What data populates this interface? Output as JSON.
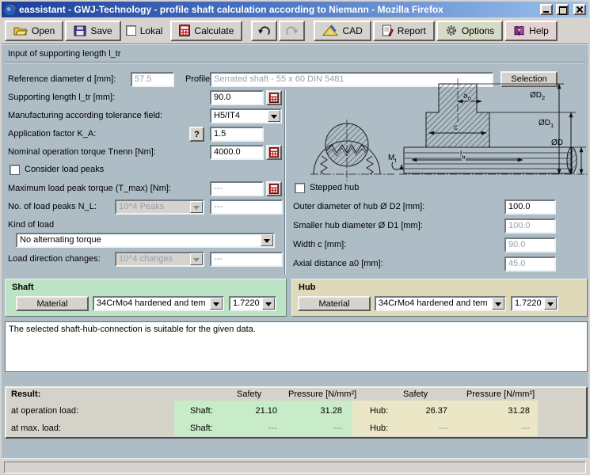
{
  "window": {
    "title": "eassistant - GWJ-Technology - profile shaft calculation according to Niemann - Mozilla Firefox"
  },
  "toolbar": {
    "open": "Open",
    "save": "Save",
    "lokal": "Lokal",
    "calculate": "Calculate",
    "cad": "CAD",
    "report": "Report",
    "options": "Options",
    "help": "Help"
  },
  "heading": "Input of supporting length l_tr",
  "form": {
    "reference_diameter": {
      "label": "Reference diameter d [mm]:",
      "value": "57.5"
    },
    "profile": {
      "label": "Profile:",
      "value": "Serrated shaft - 55 x 60 DIN 5481"
    },
    "selection_button": "Selection",
    "supporting_length": {
      "label": "Supporting length l_tr [mm]:",
      "value": "90.0"
    },
    "tolerance_field": {
      "label": "Manufacturing according tolerance field:",
      "value": "H5/IT4"
    },
    "application_factor": {
      "label": "Application factor K_A:",
      "value": "1.5",
      "help": "?"
    },
    "nominal_torque": {
      "label": "Nominal operation torque Tnenn [Nm]:",
      "value": "4000.0"
    },
    "consider_load_peaks": {
      "label": "Consider load peaks",
      "checked": false
    },
    "max_peak_torque": {
      "label": "Maximum load peak torque (T_max) [Nm]:",
      "value": "---"
    },
    "load_peaks": {
      "label": "No. of load peaks N_L:",
      "unit": "10^4 Peaks",
      "value": "---"
    },
    "kind_of_load": {
      "label": "Kind of load",
      "value": "No alternating torque"
    },
    "load_direction": {
      "label": "Load direction changes:",
      "unit": "10^4 changes",
      "value": "---"
    },
    "stepped_hub": {
      "label": "Stepped hub",
      "checked": false
    },
    "outer_diameter": {
      "label": "Outer diameter of hub Ø D2 [mm]:",
      "value": "100.0"
    },
    "smaller_diameter": {
      "label": "Smaller hub diameter Ø D1 [mm]:",
      "value": "100.0"
    },
    "width_c": {
      "label": "Width c [mm]:",
      "value": "90.0"
    },
    "axial_distance": {
      "label": "Axial distance a0 [mm]:",
      "value": "45.0"
    }
  },
  "drawing": {
    "d2_main": "ØD",
    "d2_sub": "2",
    "d1_main": "ØD",
    "d1_sub": "1",
    "d_main": "ØD",
    "a0_main": "a",
    "a0_sub": "0",
    "c_main": "c",
    "ltr_main": "l",
    "ltr_sub": "tr",
    "mt_main": "M",
    "mt_sub": "t"
  },
  "materials": {
    "shaft": {
      "title": "Shaft",
      "material_button": "Material",
      "name": "34CrMo4 hardened and tem",
      "number": "1.7220"
    },
    "hub": {
      "title": "Hub",
      "material_button": "Material",
      "name": "34CrMo4 hardened and tem",
      "number": "1.7220"
    }
  },
  "message": "The selected shaft-hub-connection is suitable for the given data.",
  "results": {
    "title": "Result:",
    "col_safety": "Safety",
    "col_pressure": "Pressure [N/mm²]",
    "rows": [
      {
        "label": "at operation load:",
        "shaft": "Shaft:",
        "s_safety": "21.10",
        "s_pressure": "31.28",
        "hub": "Hub:",
        "h_safety": "26.37",
        "h_pressure": "31.28"
      },
      {
        "label": "at max. load:",
        "shaft": "Shaft:",
        "s_safety": "---",
        "s_pressure": "---",
        "hub": "Hub:",
        "h_safety": "---",
        "h_pressure": "---"
      }
    ]
  },
  "colors": {
    "content_bg": "#aebcc6",
    "toolbar_bg": "#d6d3ce",
    "titlebar_left": "#1a3f9a",
    "titlebar_right": "#9cc2ec",
    "shaft_panel_bg": "#bce3c3",
    "hub_panel_bg": "#ded9b8",
    "result_shaft_bg": "#c8ecc8",
    "result_hub_bg": "#ebe6c6"
  }
}
